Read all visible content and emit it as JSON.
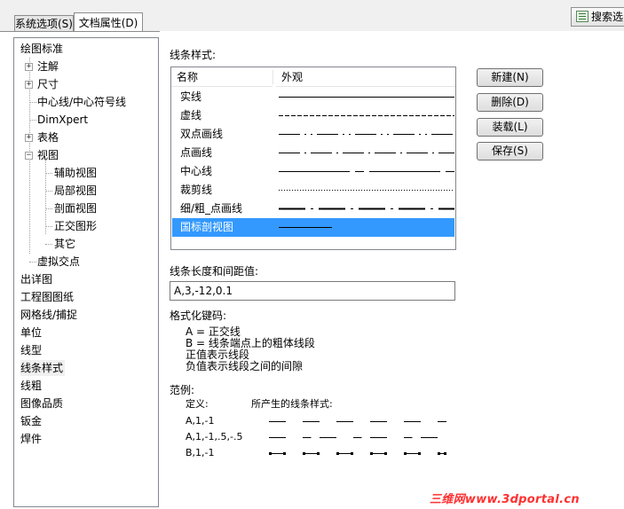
{
  "tabs": [
    {
      "label": "系统选项(S)",
      "active": false
    },
    {
      "label": "文档属性(D)",
      "active": true
    }
  ],
  "search_button": {
    "label": "搜索选",
    "icon": "search-list-icon"
  },
  "tree": {
    "items": [
      {
        "label": "绘图标准",
        "level": 0,
        "expander": null
      },
      {
        "label": "注解",
        "level": 1,
        "expander": "+"
      },
      {
        "label": "尺寸",
        "level": 1,
        "expander": "+"
      },
      {
        "label": "中心线/中心符号线",
        "level": 1,
        "expander": null
      },
      {
        "label": "DimXpert",
        "level": 1,
        "expander": null
      },
      {
        "label": "表格",
        "level": 1,
        "expander": "+"
      },
      {
        "label": "视图",
        "level": 1,
        "expander": "-"
      },
      {
        "label": "辅助视图",
        "level": 2,
        "expander": null
      },
      {
        "label": "局部视图",
        "level": 2,
        "expander": null
      },
      {
        "label": "剖面视图",
        "level": 2,
        "expander": null
      },
      {
        "label": "正交图形",
        "level": 2,
        "expander": null
      },
      {
        "label": "其它",
        "level": 2,
        "expander": null
      },
      {
        "label": "虚拟交点",
        "level": 1,
        "expander": null
      },
      {
        "label": "出详图",
        "level": 0,
        "expander": null
      },
      {
        "label": "工程图图纸",
        "level": 0,
        "expander": null
      },
      {
        "label": "网格线/捕捉",
        "level": 0,
        "expander": null
      },
      {
        "label": "单位",
        "level": 0,
        "expander": null
      },
      {
        "label": "线型",
        "level": 0,
        "expander": null
      },
      {
        "label": "线条样式",
        "level": 0,
        "expander": null,
        "selected": true
      },
      {
        "label": "线粗",
        "level": 0,
        "expander": null
      },
      {
        "label": "图像品质",
        "level": 0,
        "expander": null
      },
      {
        "label": "钣金",
        "level": 0,
        "expander": null
      },
      {
        "label": "焊件",
        "level": 0,
        "expander": null
      }
    ]
  },
  "line_styles": {
    "title": "线条样式:",
    "columns": [
      "名称",
      "外观"
    ],
    "rows": [
      {
        "name": "实线",
        "pattern": "solid"
      },
      {
        "name": "虚线",
        "pattern": "dashed"
      },
      {
        "name": "双点画线",
        "pattern": "double-dot-dash"
      },
      {
        "name": "点画线",
        "pattern": "dot-dash"
      },
      {
        "name": "中心线",
        "pattern": "center"
      },
      {
        "name": "裁剪线",
        "pattern": "dotted"
      },
      {
        "name": "细/粗_点画线",
        "pattern": "thin-thick-dash"
      },
      {
        "name": "国标剖视图",
        "pattern": "short-solid",
        "selected": true
      }
    ]
  },
  "buttons": {
    "new": "新建(N)",
    "delete": "删除(D)",
    "load": "装载(L)",
    "save": "保存(S)"
  },
  "length_spacing": {
    "label": "线条长度和间距值:",
    "value": "A,3,-12,0.1"
  },
  "format_codes": {
    "label": "格式化键码:",
    "lines": [
      "A = 正交线",
      "B = 线条端点上的粗体线段",
      "正值表示线段",
      "负值表示线段之间的间隙"
    ]
  },
  "examples": {
    "label": "范例:",
    "definition_header": "定义:",
    "result_header": "所产生的线条样式:",
    "rows": [
      {
        "definition": "A,1,-1",
        "pattern": "A,1,-1"
      },
      {
        "definition": "A,1,-1,.5,-.5",
        "pattern": "A,1,-1,.5,-.5"
      },
      {
        "definition": "B,1,-1",
        "pattern": "B,1,-1"
      }
    ]
  },
  "watermark": "三维网www.3dportal.cn",
  "colors": {
    "selection": "#3399ff",
    "watermark": "#ff3030",
    "chrome": "#f0f0f0"
  }
}
